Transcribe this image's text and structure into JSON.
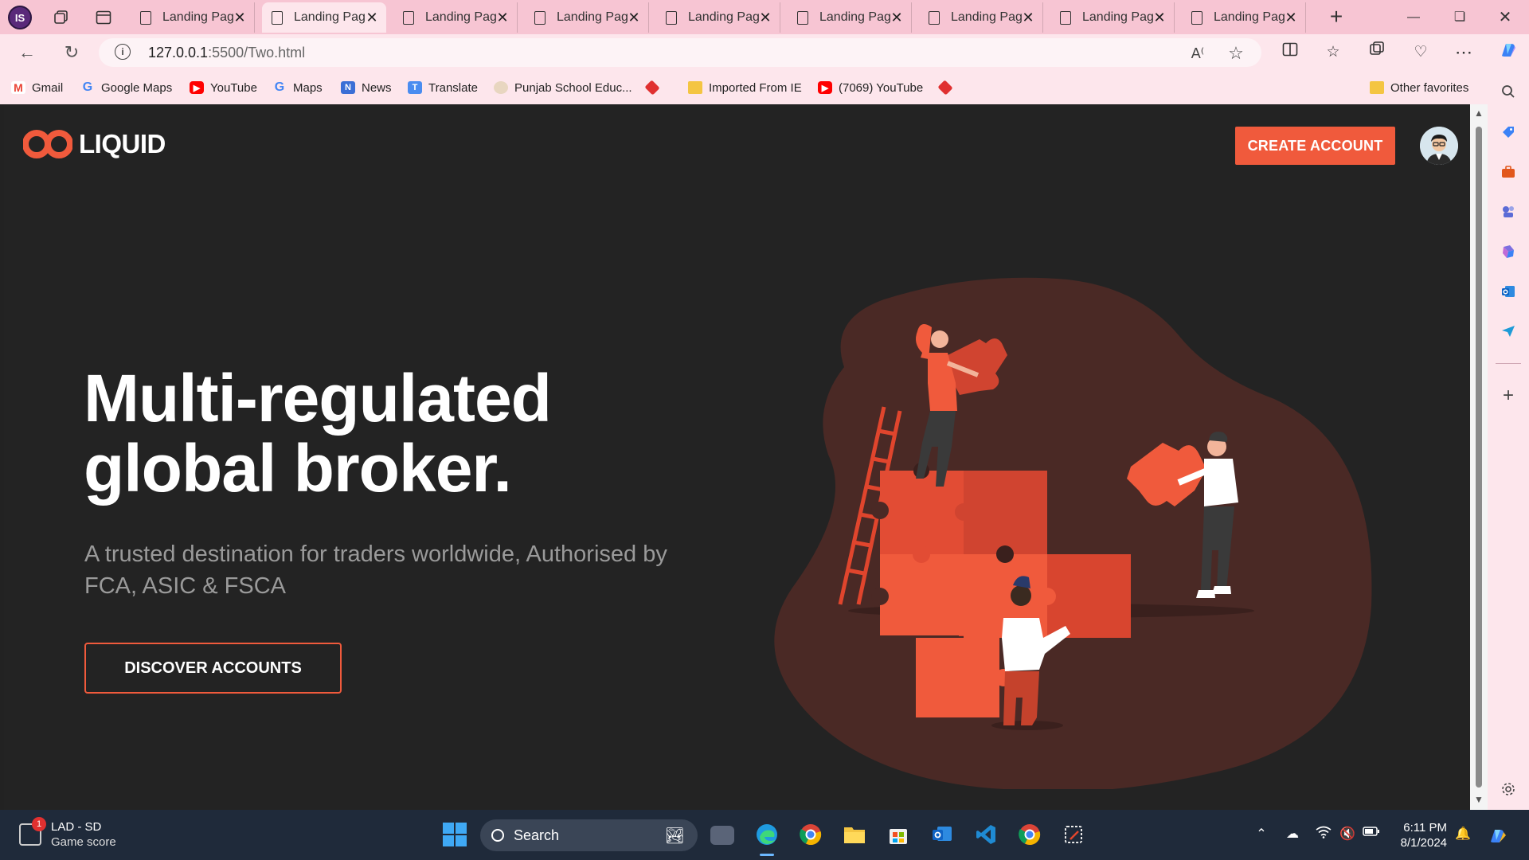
{
  "browser": {
    "profile_initials": "IS",
    "tabs": [
      {
        "title": "Landing Page",
        "active": false
      },
      {
        "title": "Landing Page",
        "active": true
      },
      {
        "title": "Landing Page",
        "active": false
      },
      {
        "title": "Landing Page",
        "active": false
      },
      {
        "title": "Landing Page",
        "active": false
      },
      {
        "title": "Landing Page",
        "active": false
      },
      {
        "title": "Landing Page",
        "active": false
      },
      {
        "title": "Landing Page",
        "active": false
      },
      {
        "title": "Landing Page",
        "active": false
      }
    ],
    "url_host": "127.0.0.1",
    "url_path": ":5500/Two.html",
    "favorites": [
      {
        "label": "Gmail",
        "icon": "gmail-icon"
      },
      {
        "label": "Google Maps",
        "icon": "google-icon"
      },
      {
        "label": "YouTube",
        "icon": "youtube-icon"
      },
      {
        "label": "Maps",
        "icon": "google-icon"
      },
      {
        "label": "News",
        "icon": "news-icon"
      },
      {
        "label": "Translate",
        "icon": "translate-icon"
      },
      {
        "label": "Punjab School Educ...",
        "icon": "punjab-icon"
      },
      {
        "label": "",
        "icon": "diamond-icon"
      },
      {
        "label": "Imported From IE",
        "icon": "folder-icon"
      },
      {
        "label": "(7069) YouTube",
        "icon": "youtube-icon"
      },
      {
        "label": "",
        "icon": "diamond-icon"
      }
    ],
    "other_favorites": "Other favorites"
  },
  "page": {
    "logo_text": "LIQUID",
    "create_account": "CREATE ACCOUNT",
    "hero_line1": "Multi-regulated",
    "hero_line2": "global broker.",
    "hero_subtitle": "A trusted destination for traders worldwide, Authorised by FCA, ASIC & FSCA",
    "discover_button": "DISCOVER ACCOUNTS",
    "accent_color": "#f05a3c",
    "background_color": "#232323"
  },
  "taskbar": {
    "widget_title": "LAD - SD",
    "widget_subtitle": "Game score",
    "widget_badge": "1",
    "search_label": "Search",
    "time": "6:11 PM",
    "date": "8/1/2024"
  }
}
